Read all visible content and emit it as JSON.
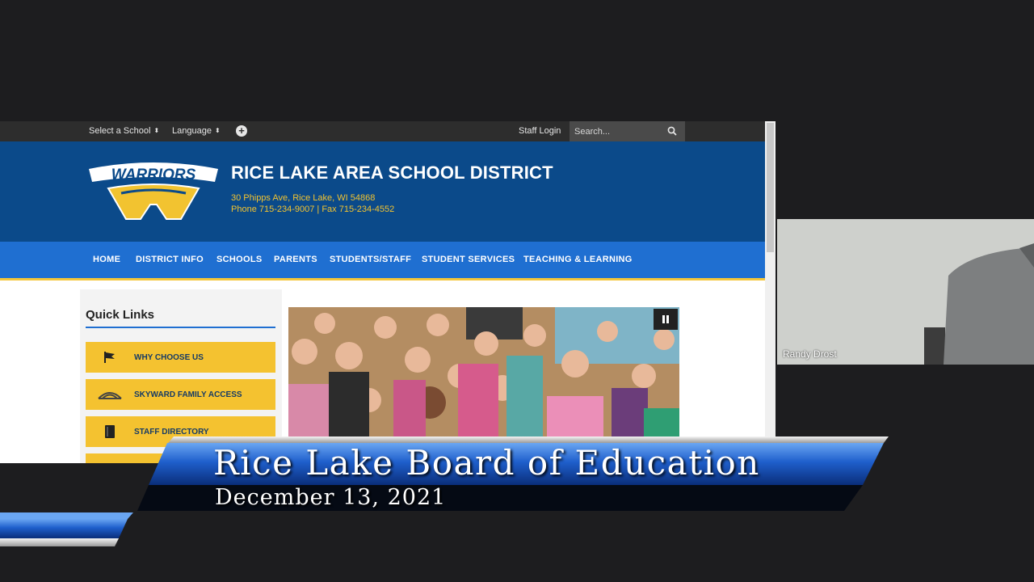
{
  "utility_bar": {
    "select_school": "Select a School",
    "language": "Language",
    "staff_login": "Staff Login",
    "search_placeholder": "Search..."
  },
  "header": {
    "logo_text": "WARRIORS",
    "title": "RICE LAKE AREA SCHOOL DISTRICT",
    "address": "30 Phipps Ave, Rice Lake, WI 54868",
    "phone": "Phone 715-234-9007 | Fax 715-234-4552"
  },
  "nav": {
    "items": [
      {
        "label": "HOME"
      },
      {
        "label": "DISTRICT INFO"
      },
      {
        "label": "SCHOOLS"
      },
      {
        "label": "PARENTS"
      },
      {
        "label": "STUDENTS/STAFF"
      },
      {
        "label": "STUDENT SERVICES"
      },
      {
        "label": "TEACHING & LEARNING"
      }
    ]
  },
  "quick_links": {
    "title": "Quick Links",
    "items": [
      {
        "label": "WHY CHOOSE US",
        "icon": "flag-icon"
      },
      {
        "label": "SKYWARD FAMILY ACCESS",
        "icon": "skyward-icon"
      },
      {
        "label": "STAFF DIRECTORY",
        "icon": "book-icon"
      }
    ]
  },
  "participant": {
    "name": "Randy Drost"
  },
  "banner": {
    "title": "Rice Lake Board of Education",
    "date": "December 13, 2021"
  },
  "colors": {
    "header_blue": "#0b4a8a",
    "nav_blue": "#1f6fd1",
    "accent_gold": "#f4c230"
  }
}
